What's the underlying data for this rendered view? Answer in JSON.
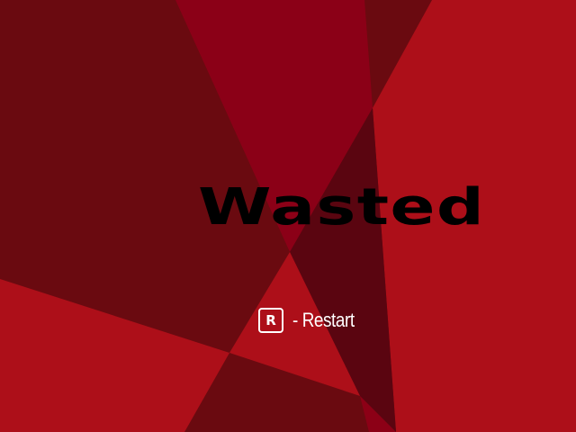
{
  "screen": {
    "title": "Wasted",
    "colors": {
      "background_dark": "#6a0a10",
      "background_mid": "#8c0016",
      "background_bright": "#ad0f19",
      "background_deep": "#590510",
      "title": "#000000",
      "hint_text": "#ffffff"
    }
  },
  "restart_hint": {
    "key_icon": "r-key-icon",
    "key": "R",
    "label": "- Restart"
  }
}
